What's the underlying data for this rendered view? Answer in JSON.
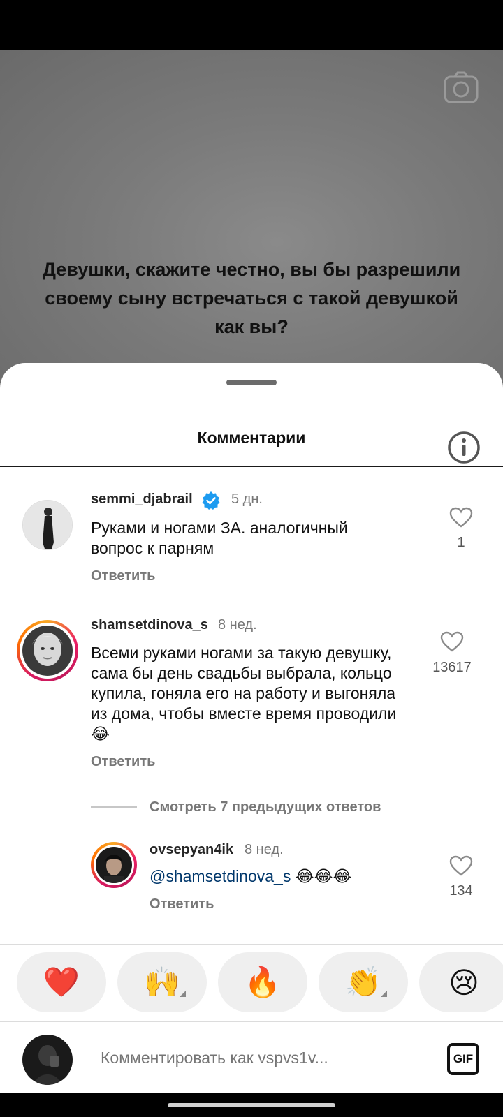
{
  "story": {
    "question": "Девушки, скажите честно, вы бы разрешили своему сыну встречаться с такой девушкой как вы?"
  },
  "sheet": {
    "title": "Комментарии"
  },
  "comments": [
    {
      "username": "semmi_djabrail",
      "verified": true,
      "time": "5 дн.",
      "text": "Руками и ногами ЗА. аналогичный вопрос к парням",
      "reply_label": "Ответить",
      "likes": "1"
    },
    {
      "username": "shamsetdinova_s",
      "verified": false,
      "time": "8 нед.",
      "text": "Всеми руками ногами за такую девушку, сама бы день свадьбы выбрала, кольцо купила, гоняла его на работу и выгоняла из дома, чтобы вместе время проводили😂",
      "reply_label": "Ответить",
      "likes": "13617"
    }
  ],
  "view_replies": "Смотреть 7 предыдущих ответов",
  "reply": {
    "username": "ovsepyan4ik",
    "time": "8 нед.",
    "mention": "@shamsetdinova_s",
    "emojis": "😂😂😂",
    "reply_label": "Ответить",
    "likes": "134"
  },
  "reactions": [
    "❤️",
    "🙌",
    "🔥",
    "👏",
    "😢"
  ],
  "composer": {
    "placeholder": "Комментировать как vspvs1v...",
    "gif_label": "GIF"
  },
  "colors": {
    "verified": "#1d9bf0",
    "link": "#00376b",
    "ring_start": "#f9a825",
    "ring_end": "#d81b60"
  }
}
